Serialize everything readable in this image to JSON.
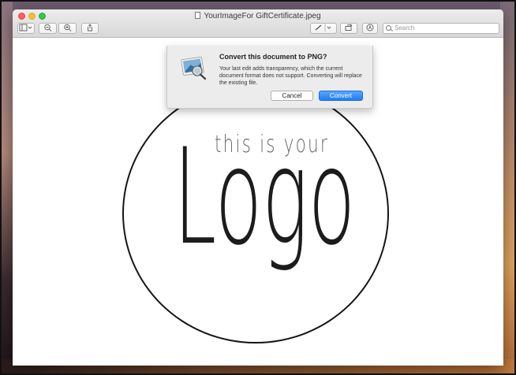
{
  "window": {
    "title": "YourImageFor GiftCertificate.jpeg",
    "traffic_lights": [
      "close",
      "minimize",
      "zoom"
    ]
  },
  "toolbar": {
    "buttons": [
      {
        "name": "sidebar-toggle",
        "icon": "sidebar-icon"
      },
      {
        "name": "zoom-out",
        "icon": "zoom-out-icon"
      },
      {
        "name": "zoom-in",
        "icon": "zoom-in-icon"
      },
      {
        "name": "share",
        "icon": "share-icon"
      },
      {
        "name": "markup-pen",
        "icon": "pen-icon"
      },
      {
        "name": "rotate",
        "icon": "rotate-icon"
      },
      {
        "name": "annotate",
        "icon": "markup-icon"
      }
    ],
    "search_placeholder": "Search"
  },
  "image": {
    "line1": "this is your",
    "line2": "Logo"
  },
  "dialog": {
    "title": "Convert this document to PNG?",
    "message": "Your last edit adds transparency, which the current document format does not support. Converting will replace the existing file.",
    "cancel_label": "Cancel",
    "convert_label": "Convert"
  },
  "colors": {
    "accent": "#1f7cf3",
    "close": "#fc605c",
    "minimize": "#fdbc40",
    "zoom": "#34c84a"
  }
}
